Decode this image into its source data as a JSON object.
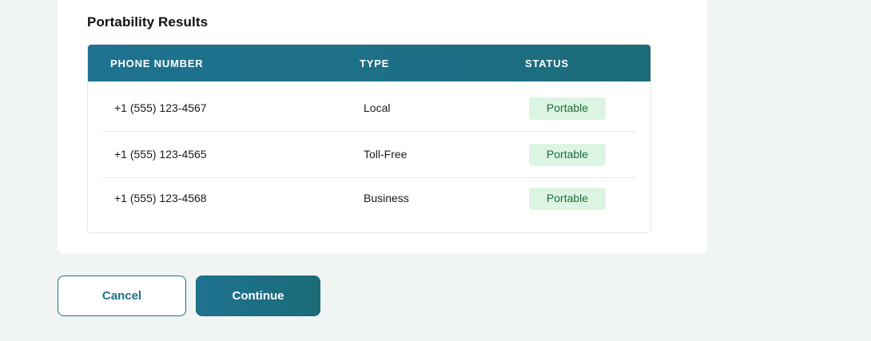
{
  "section": {
    "title": "Portability Results"
  },
  "table": {
    "headers": [
      "PHONE NUMBER",
      "TYPE",
      "STATUS"
    ],
    "rows": [
      {
        "phone": "+1 (555) 123-4567",
        "type": "Local",
        "status": "Portable"
      },
      {
        "phone": "+1 (555) 123-4565",
        "type": "Toll-Free",
        "status": "Portable"
      },
      {
        "phone": "+1 (555) 123-4568",
        "type": "Business",
        "status": "Portable"
      }
    ]
  },
  "actions": {
    "cancel_label": "Cancel",
    "continue_label": "Continue"
  },
  "colors": {
    "accent": "#1d6f86",
    "badge_bg": "#dcf5e3",
    "badge_text": "#1f6b3a",
    "page_bg": "#f0f5f4"
  }
}
